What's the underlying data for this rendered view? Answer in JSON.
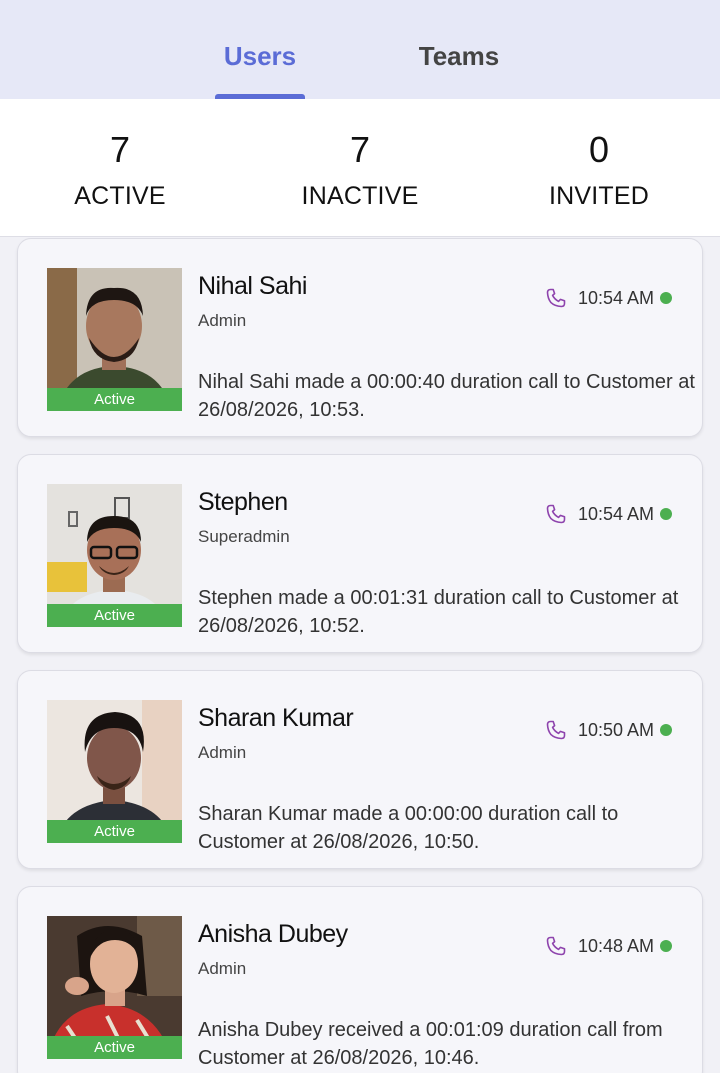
{
  "tabs": [
    {
      "label": "Users",
      "active": true
    },
    {
      "label": "Teams",
      "active": false
    }
  ],
  "stats": [
    {
      "value": "7",
      "label": "ACTIVE"
    },
    {
      "value": "7",
      "label": "INACTIVE"
    },
    {
      "value": "0",
      "label": "INVITED"
    }
  ],
  "colors": {
    "accent": "#5b6cd6",
    "status_green": "#4caf50",
    "phone_icon": "#8e44ad"
  },
  "users": [
    {
      "name": "Nihal Sahi",
      "role": "Admin",
      "status": "Active",
      "time": "10:54 AM",
      "icon": "phone-icon",
      "message": "Nihal Sahi made a 00:00:40 duration call to Customer at 26/08/2026, 10:53."
    },
    {
      "name": "Stephen",
      "role": "Superadmin",
      "status": "Active",
      "time": "10:54 AM",
      "icon": "phone-icon",
      "message": "Stephen made a 00:01:31 duration call to Customer at 26/08/2026, 10:52."
    },
    {
      "name": "Sharan Kumar",
      "role": "Admin",
      "status": "Active",
      "time": "10:50 AM",
      "icon": "phone-icon",
      "message": "Sharan Kumar made a 00:00:00 duration call to Customer at 26/08/2026, 10:50."
    },
    {
      "name": "Anisha Dubey",
      "role": "Admin",
      "status": "Active",
      "time": "10:48 AM",
      "icon": "phone-icon",
      "message": "Anisha Dubey received a 00:01:09 duration call from Customer at 26/08/2026, 10:46."
    }
  ]
}
